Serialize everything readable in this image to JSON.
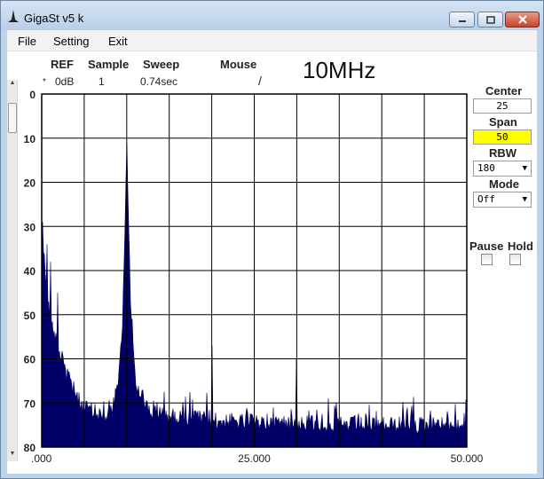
{
  "window": {
    "title": "GigaSt v5 k"
  },
  "menu": [
    "File",
    "Setting",
    "Exit"
  ],
  "header": {
    "ref_label": "REF",
    "ref_value": "0dB",
    "ref_marker": "*",
    "sample_label": "Sample",
    "sample_value": "1",
    "sweep_label": "Sweep",
    "sweep_value": "0.74sec",
    "mouse_label": "Mouse",
    "mouse_value": "/",
    "freq_text": "10MHz"
  },
  "controls": {
    "center_label": "Center",
    "center_value": "25",
    "span_label": "Span",
    "span_value": "50",
    "rbw_label": "RBW",
    "rbw_value": "180",
    "mode_label": "Mode",
    "mode_value": "Off",
    "pause_label": "Pause",
    "hold_label": "Hold"
  },
  "colors": {
    "trace": "#000066",
    "span_highlight": "#ffff00",
    "grid": "#000000"
  },
  "chart_data": {
    "type": "area",
    "x_tick_labels": [
      ".000",
      "25.000",
      "50.000"
    ],
    "y_tick_labels": [
      "0",
      "10",
      "20",
      "30",
      "40",
      "50",
      "60",
      "70",
      "80"
    ],
    "xlim": [
      0,
      50
    ],
    "ylim": [
      0,
      80
    ],
    "y_inverted": true,
    "grid": true,
    "x_divisions": 10,
    "y_divisions": 8,
    "noise_floor": 75,
    "profile_x": [
      0,
      0.2,
      0.5,
      0.8,
      1.2,
      1.6,
      2.0,
      2.5,
      3.0,
      3.5,
      4.0,
      4.5,
      5.0,
      6.0,
      7.0,
      8.0,
      9.0,
      9.5,
      9.8,
      10.0,
      10.2,
      10.5,
      11.0,
      12.0,
      13.0,
      15.0,
      20.0,
      25.0,
      30.0,
      35.0,
      40.0,
      45.0,
      50.0
    ],
    "profile_y": [
      29,
      35,
      42,
      48,
      52,
      55,
      58,
      61,
      64,
      66,
      68,
      70,
      71,
      72,
      73,
      73,
      66,
      52,
      30,
      12,
      28,
      50,
      64,
      70,
      72,
      73,
      74,
      74.5,
      74.5,
      75,
      75,
      75,
      75
    ],
    "spurs": [
      {
        "x": 0.1,
        "y": 29
      },
      {
        "x": 0.6,
        "y": 34
      },
      {
        "x": 1.0,
        "y": 38
      },
      {
        "x": 1.9,
        "y": 45
      },
      {
        "x": 10.0,
        "y": 11
      },
      {
        "x": 20.0,
        "y": 57
      },
      {
        "x": 30.0,
        "y": 60
      }
    ]
  }
}
